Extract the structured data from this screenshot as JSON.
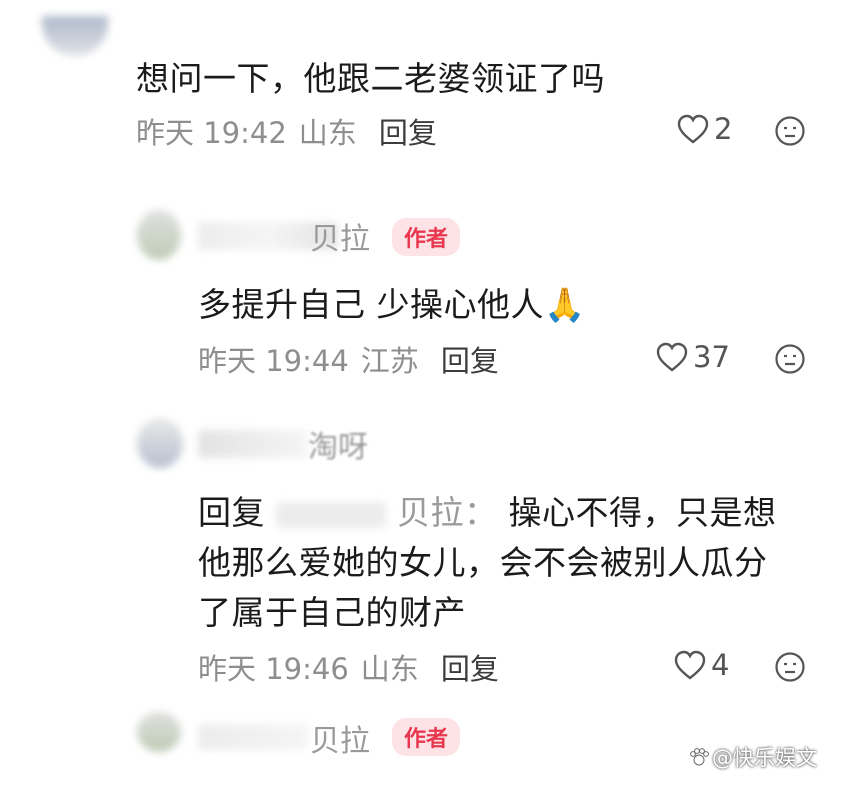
{
  "comments": [
    {
      "text": "想问一下，他跟二老婆领证了吗",
      "time": "昨天 19:42",
      "location": "山东",
      "reply_label": "回复",
      "likes": "2"
    },
    {
      "username": "贝拉",
      "badge": "作者",
      "text": "多提升自己 少操心他人🙏",
      "time": "昨天 19:44",
      "location": "江苏",
      "reply_label": "回复",
      "likes": "37"
    },
    {
      "username": "淘呀",
      "reply_prefix": "回复",
      "reply_to": "贝拉：",
      "text_lines": [
        "操心不得，只是想",
        "他那么爱她的女儿，会不会被别人瓜分",
        "了属于自己的财产"
      ],
      "time": "昨天 19:46",
      "location": "山东",
      "reply_label": "回复",
      "likes": "4"
    },
    {
      "username": "贝拉",
      "badge": "作者"
    }
  ],
  "watermark": "@快乐娱文",
  "colors": {
    "badge_bg": "#fde3e6",
    "badge_text": "#e8384f",
    "meta": "#8e8e8e",
    "text": "#1b1b1b"
  },
  "icons": {
    "like": "heart-outline-icon",
    "dislike": "frown-face-icon",
    "watermark": "paw-icon"
  }
}
